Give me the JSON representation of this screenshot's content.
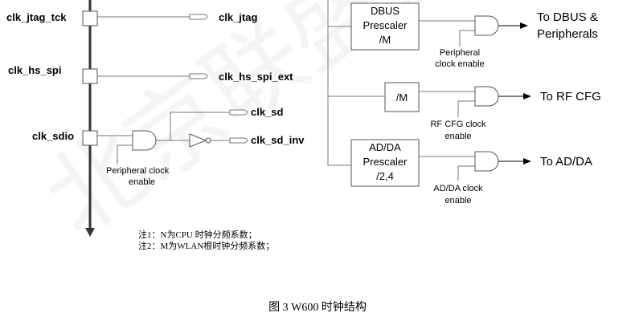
{
  "watermark": "北京联盛德",
  "left_signals": {
    "jtag_in": "clk_jtag_tck",
    "jtag_out": "clk_jtag",
    "hsspi_in": "clk_hs_spi",
    "hsspi_out": "clk_hs_spi_ext",
    "sdio_in": "clk_sdio",
    "sd_out": "clk_sd",
    "sd_inv_out": "clk_sd_inv",
    "peripheral_enable": [
      "Peripheral clock",
      "enable"
    ]
  },
  "right_blocks": {
    "dbus_box": [
      "DBUS",
      "Prescaler",
      "/M"
    ],
    "dbus_enable": [
      "Peripheral",
      "clock enable"
    ],
    "dbus_out": [
      "To DBUS &",
      "Peripherals"
    ],
    "rf_box": "/M",
    "rf_enable": [
      "RF CFG clock",
      "enable"
    ],
    "rf_out": "To RF CFG",
    "adda_box": [
      "AD/DA",
      "Prescaler",
      "/2,4"
    ],
    "adda_enable": [
      "AD/DA clock",
      "enable"
    ],
    "adda_out": "To AD/DA"
  },
  "notes": [
    "注1：N为CPU 时钟分频系数；",
    "注2：M为WLAN根时钟分频系数；"
  ],
  "caption": "图  3 W600  时钟结构"
}
